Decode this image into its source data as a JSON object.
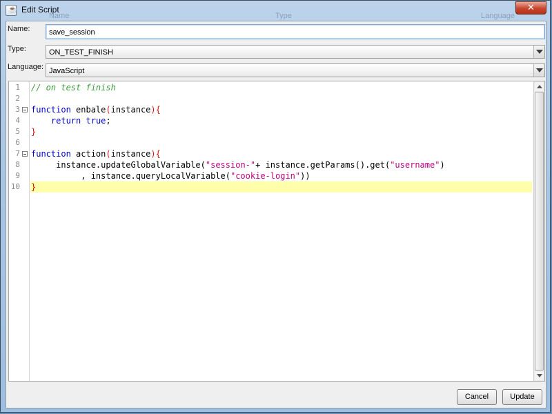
{
  "window": {
    "title": "Edit Script",
    "close_glyph": "✕",
    "app_icon": "java-cup-icon"
  },
  "background": {
    "labels": [
      "Name",
      "Type",
      "Language"
    ]
  },
  "form": {
    "name_label": "Name:",
    "name_value": "save_session",
    "type_label": "Type:",
    "type_value": "ON_TEST_FINISH",
    "language_label": "Language:",
    "language_value": "JavaScript"
  },
  "editor": {
    "line_numbers": [
      "1",
      "2",
      "3",
      "4",
      "5",
      "6",
      "7",
      "8",
      "9",
      "10"
    ],
    "highlight_color": "#ffffaa",
    "keyword_color": "#0000c8",
    "comment_color": "#3f9a3f",
    "string_color": "#c0007f",
    "brace_color": "#e01010"
  },
  "buttons": {
    "cancel": "Cancel",
    "update": "Update"
  }
}
